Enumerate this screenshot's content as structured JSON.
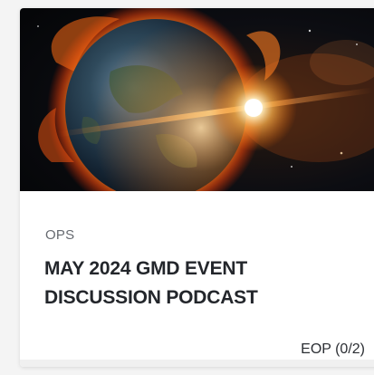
{
  "card": {
    "image_alt": "Earth hit by a solar storm",
    "category": "OPS",
    "title": "MAY 2024 GMD EVENT DISCUSSION PODCAST",
    "progress_label": "EOP (0/2)"
  },
  "colors": {
    "page_background": "#f4f4f4",
    "card_background": "#ffffff",
    "category_text": "#666a70",
    "title_text": "#23262b"
  }
}
